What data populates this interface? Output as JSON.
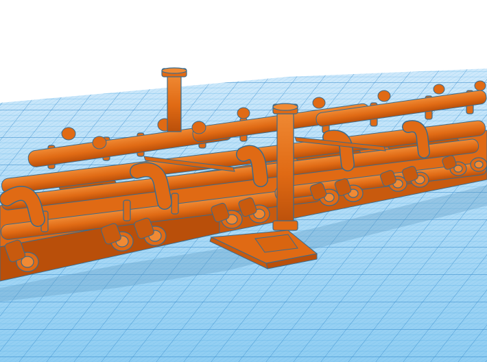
{
  "viewport": {
    "background": "#ffffff",
    "grid_color": "#4aa8e0",
    "grid_major_color": "#2f86c9",
    "model_color": "#e06a14",
    "model_dark": "#b94f0a",
    "model_outline": "#3b6b8c"
  }
}
